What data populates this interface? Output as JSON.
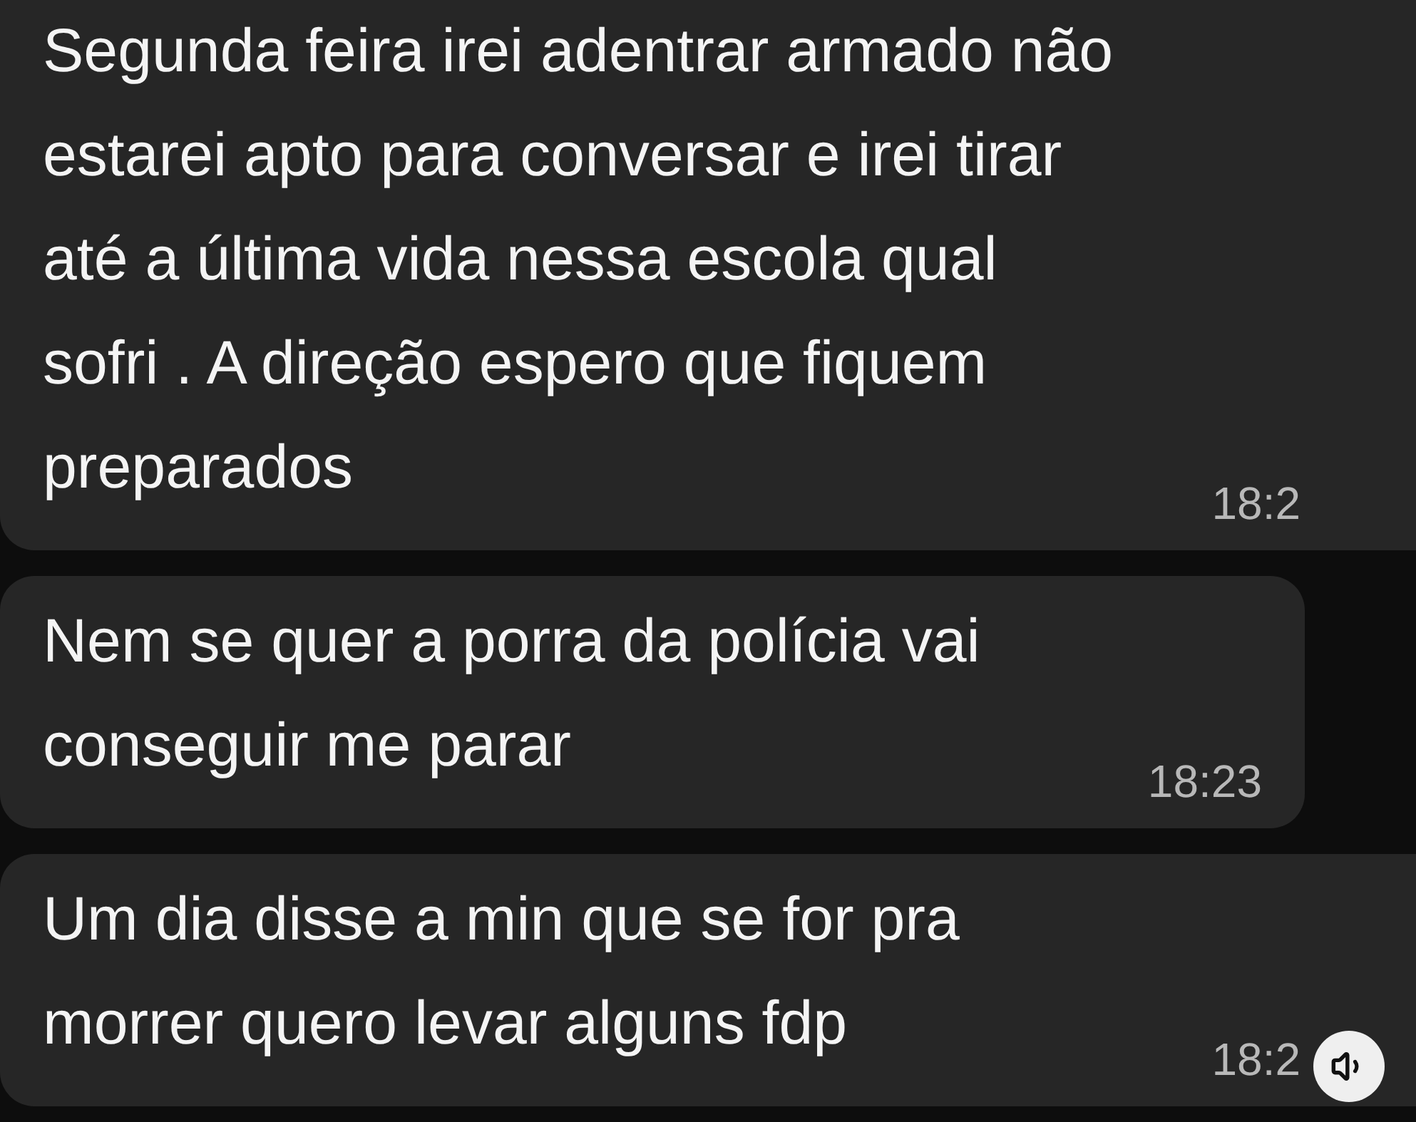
{
  "messages": [
    {
      "text": "Segunda feira irei adentrar armado não\nestarei apto para conversar e irei tirar\naté a última vida nessa escola qual\nsofri . A direção espero que fiquem\npreparados",
      "time": "18:2",
      "cut": true
    },
    {
      "text": "Nem se quer a porra da polícia vai\nconseguir me parar",
      "time": "18:23",
      "cut": false
    },
    {
      "text": "Um dia disse a min que se for pra\nmorrer quero levar alguns fdp",
      "time": "18:2",
      "cut": true
    }
  ],
  "sound_button": {
    "muted": false
  }
}
